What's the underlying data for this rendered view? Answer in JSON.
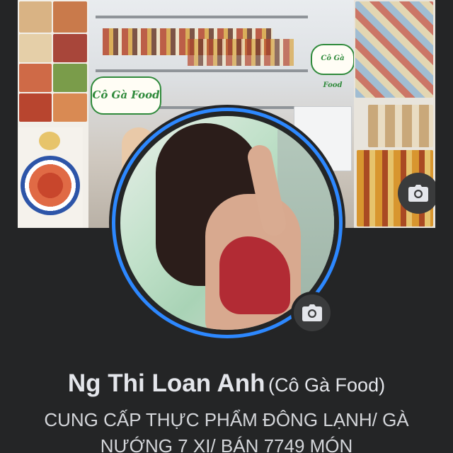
{
  "profile": {
    "name": "Ng Thi Loan Anh",
    "alternate_name": "(Cô Gà Food)",
    "bio": "CUNG CẤP THỰC PHẨM ĐÔNG LẠNH/ GÀ NƯỚNG 7 XI/ BÁN 7749 MÓN"
  },
  "cover": {
    "sign_text": "Cô Gà Food",
    "sign_text_2": "Cô Gà Food",
    "camera_icon": "camera-icon"
  },
  "avatar": {
    "story_ring_color": "#2d88ff",
    "camera_icon": "camera-icon"
  },
  "theme": {
    "background": "#242526",
    "accent": "#2d88ff"
  }
}
